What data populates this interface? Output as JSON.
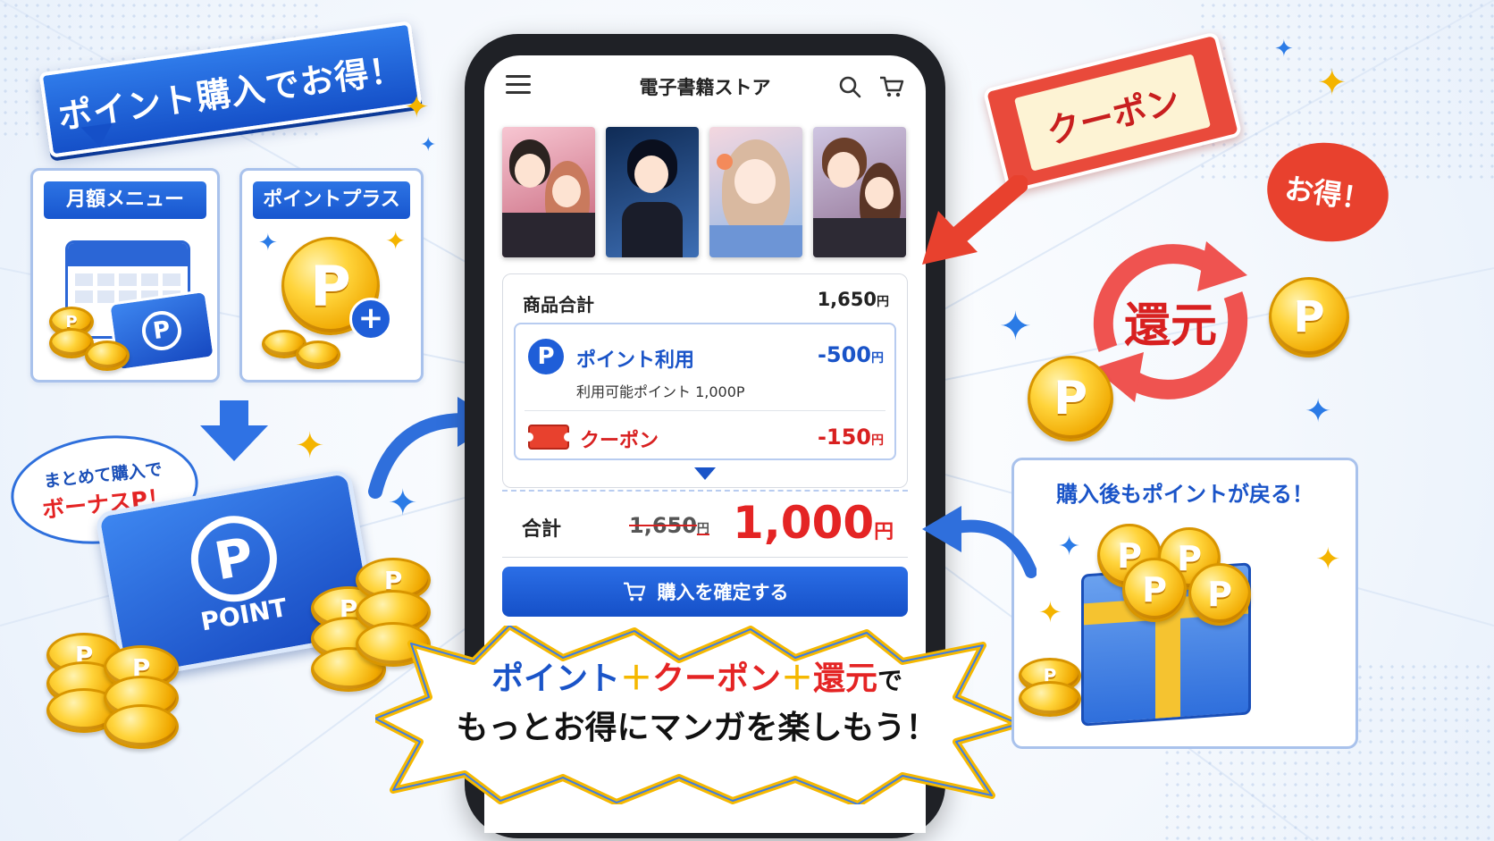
{
  "colors": {
    "brand_blue": "#1856cf",
    "accent_red": "#e42424",
    "coin_gold": "#ffd43b",
    "coupon_bg": "#fdf3d4"
  },
  "left": {
    "banner": "ポイント購入でお得！",
    "monthly_card": {
      "title": "月額メニュー"
    },
    "point_plus_card": {
      "title": "ポイントプラス"
    },
    "bubble": {
      "line1": "まとめて購入で",
      "line2": "ボーナスP！"
    },
    "point_card_label": "POINT",
    "coin_letter": "P"
  },
  "phone": {
    "app_title": "電子書籍ストア",
    "summary": {
      "subtotal_label": "商品合計",
      "subtotal_value": "1,650",
      "yen": "円",
      "point_use_label": "ポイント利用",
      "point_use_value": "-500",
      "point_available": "利用可能ポイント 1,000P",
      "coupon_label": "クーポン",
      "coupon_value": "-150"
    },
    "total": {
      "label": "合計",
      "original": "1,650",
      "final": "1,000"
    },
    "confirm_button": "購入を確定する"
  },
  "bottom_banner": {
    "part_point": "ポイント",
    "plus1": "＋",
    "part_coupon": "クーポン",
    "plus2": "＋",
    "part_kangen": "還元",
    "part_de": "で",
    "line2": "もっとお得にマンガを楽しもう！"
  },
  "right": {
    "coupon_ticket": "クーポン",
    "otoku_bubble": "お得！",
    "kangen": "還元",
    "return_card_title": "購入後もポイントが戻る！"
  }
}
